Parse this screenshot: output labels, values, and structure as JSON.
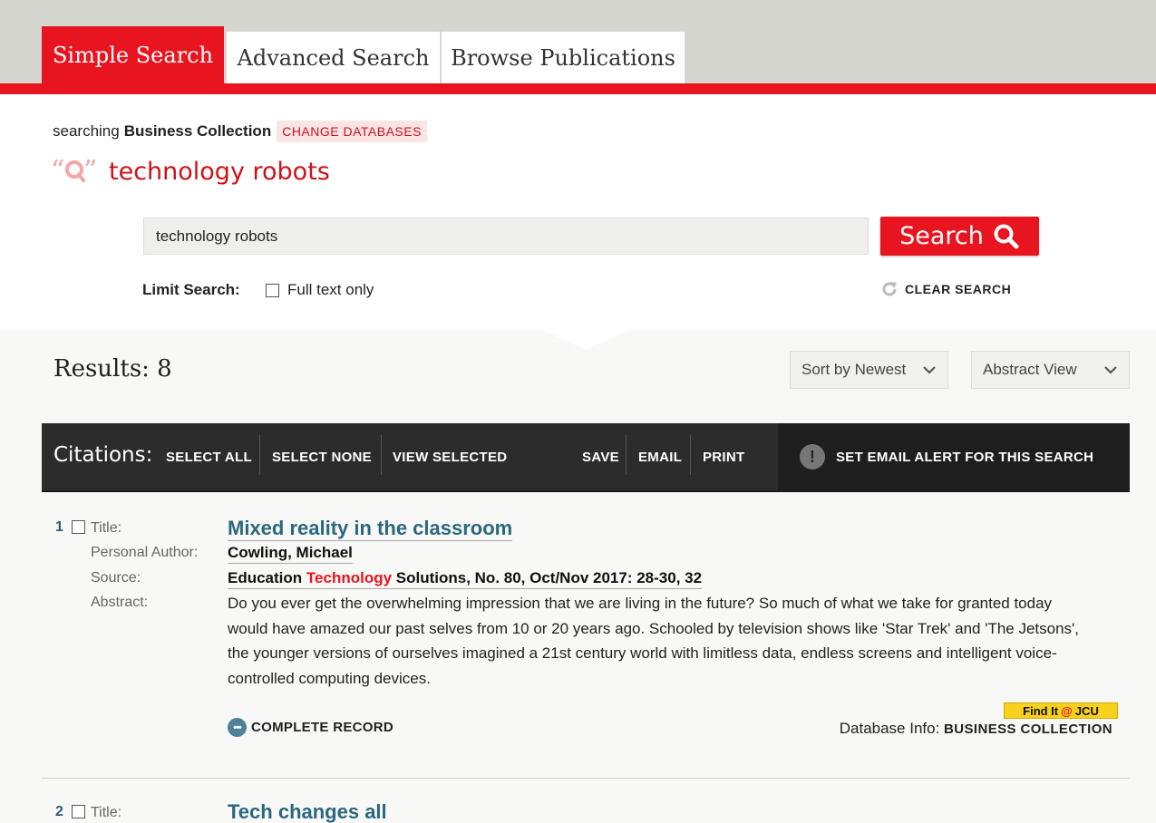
{
  "tabs": [
    {
      "label": "Simple Search",
      "active": true
    },
    {
      "label": "Advanced Search",
      "active": false
    },
    {
      "label": "Browse Publications",
      "active": false
    }
  ],
  "search": {
    "searching_prefix": "searching",
    "database": "Business Collection",
    "change_databases": "CHANGE DATABASES",
    "query_title": "technology robots",
    "input_value": "technology robots",
    "button_label": "Search",
    "limit_label": "Limit Search:",
    "fulltext_label": "Full text only",
    "fulltext_checked": false,
    "clear_label": "CLEAR SEARCH"
  },
  "results": {
    "label": "Results: 8",
    "sort": "Sort by Newest",
    "view": "Abstract View"
  },
  "citations": {
    "label": "Citations:",
    "select_all": "SELECT ALL",
    "select_none": "SELECT NONE",
    "view_selected": "VIEW SELECTED",
    "save": "SAVE",
    "email": "EMAIL",
    "print": "PRINT",
    "alert": "SET EMAIL ALERT FOR THIS SEARCH"
  },
  "labels": {
    "title": "Title:",
    "author": "Personal Author:",
    "source": "Source:",
    "abstract": "Abstract:",
    "complete_record": "COMPLETE RECORD",
    "db_info": "Database Info:",
    "findit_pre": "Find It",
    "findit_at": "@",
    "findit_post": "JCU"
  },
  "records": [
    {
      "num": "1",
      "title": "Mixed reality in the classroom",
      "author": "Cowling, Michael",
      "source_pre": "Education ",
      "source_hl": "Technology",
      "source_post": " Solutions, No. 80, Oct/Nov 2017: 28-30, 32",
      "abstract": "Do you ever get the overwhelming impression that we are living in the future? So much of what we take for granted today would have amazed our past selves from 10 or 20 years ago. Schooled by television shows like 'Star Trek' and 'The Jetsons', the younger versions of ourselves imagined a 21st century world with limitless data, endless screens and intelligent voice-controlled computing devices.",
      "database": "BUSINESS COLLECTION"
    },
    {
      "num": "2",
      "title": "Tech changes all"
    }
  ],
  "colors": {
    "brand_red": "#e8141f",
    "link_teal": "#2a6880",
    "dark_bar": "#2c2c2c",
    "findit_yellow": "#f7d11e"
  }
}
